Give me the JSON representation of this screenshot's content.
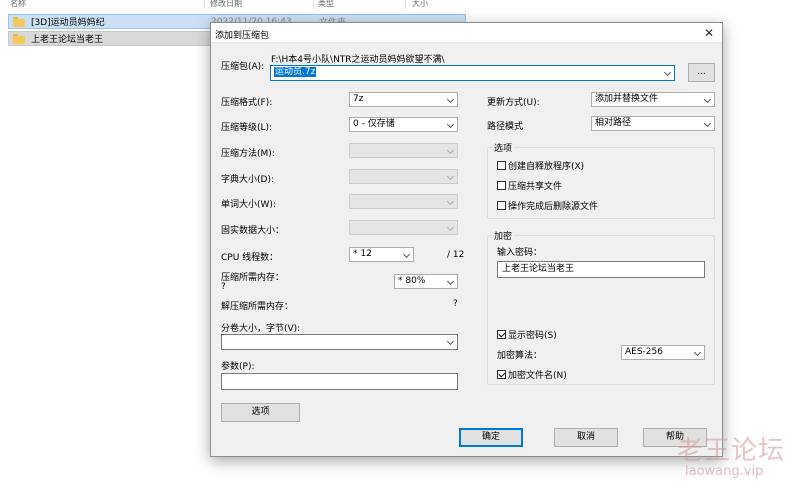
{
  "explorer": {
    "columns": [
      "名称",
      "修改日期",
      "类型",
      "大小"
    ],
    "files": [
      {
        "name": "[3D]运动员妈妈纪",
        "date": "2022/11/20 16:43",
        "type": "文件夹"
      },
      {
        "name": "上老王论坛当老王",
        "date": "",
        "type": ""
      }
    ]
  },
  "dialog": {
    "title": "添加到压缩包",
    "close_icon": "close-icon",
    "archive_label": "压缩包(A):",
    "archive_path": "F:\\H本4号小队\\NTR之运动员妈妈欲望不满\\",
    "archive_name": "运动员.7z",
    "browse_label": "...",
    "format_label": "压缩格式(F):",
    "format_value": "7z",
    "level_label": "压缩等级(L):",
    "level_value": "0 - 仅存储",
    "method_label": "压缩方法(M):",
    "dict_label": "字典大小(D):",
    "word_label": "单词大小(W):",
    "solid_label": "固实数据大小：",
    "cpu_label": "CPU 线程数：",
    "cpu_value": "* 12",
    "cpu_max": "/ 12",
    "mem_label": "压缩所需内存：",
    "mem_q": "?",
    "mem_value": "* 80%",
    "decomp_label": "解压缩所需内存：",
    "decomp_q": "?",
    "split_label": "分卷大小，字节(V):",
    "params_label": "参数(P):",
    "options_btn": "选项",
    "update_label": "更新方式(U):",
    "update_value": "添加并替换文件",
    "path_label": "路径模式",
    "path_value": "相对路径",
    "options_group": "选项",
    "opt_sfx": "创建自释放程序(X)",
    "opt_shared": "压缩共享文件",
    "opt_delete": "操作完成后删除源文件",
    "encrypt_group": "加密",
    "pwd_label": "输入密码：",
    "pwd_value": "上老王论坛当老王",
    "show_pwd": "显示密码(S)",
    "enc_method_label": "加密算法：",
    "enc_method_value": "AES-256",
    "enc_names": "加密文件名(N)",
    "ok": "确定",
    "cancel": "取消",
    "help": "帮助"
  },
  "watermark": {
    "text": "老王论坛",
    "url": "laowang.vip"
  }
}
